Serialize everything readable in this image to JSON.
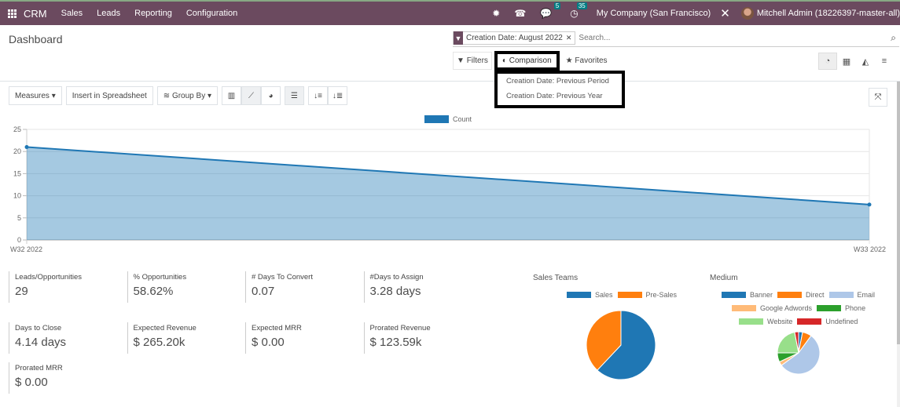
{
  "navbar": {
    "app_name": "CRM",
    "menus": [
      "Sales",
      "Leads",
      "Reporting",
      "Configuration"
    ],
    "messages_badge": "5",
    "activities_badge": "35",
    "company": "My Company (San Francisco)",
    "user": "Mitchell Admin (18226397-master-all)"
  },
  "control": {
    "title": "Dashboard",
    "facet_label": "Creation Date: August 2022",
    "search_placeholder": "Search...",
    "filters_label": "Filters",
    "comparison_label": "Comparison",
    "favorites_label": "Favorites",
    "comparison_options": [
      "Creation Date: Previous Period",
      "Creation Date: Previous Year"
    ],
    "views": [
      "dashboard",
      "pivot",
      "graph",
      "list"
    ],
    "active_view": "dashboard"
  },
  "toolbar": {
    "measures_label": "Measures",
    "insert_label": "Insert in Spreadsheet",
    "group_by_label": "Group By",
    "active_chart_mode": "line",
    "stacked": true
  },
  "kpis": [
    {
      "label": "Leads/Opportunities",
      "value": "29"
    },
    {
      "label": "% Opportunities",
      "value": "58.62%"
    },
    {
      "label": "# Days To Convert",
      "value": "0.07"
    },
    {
      "label": "#Days to Assign",
      "value": "3.28 days"
    },
    {
      "label": "Days to Close",
      "value": "4.14 days"
    },
    {
      "label": "Expected Revenue",
      "value": "$ 265.20k"
    },
    {
      "label": "Expected MRR",
      "value": "$ 0.00"
    },
    {
      "label": "Prorated Revenue",
      "value": "$ 123.59k"
    },
    {
      "label": "Prorated MRR",
      "value": "$ 0.00"
    }
  ],
  "chart_data": [
    {
      "type": "area",
      "title": "",
      "legend": [
        "Count"
      ],
      "legend_position": "top-center",
      "x": [
        "W32 2022",
        "W33 2022"
      ],
      "series": [
        {
          "name": "Count",
          "values": [
            21,
            8
          ],
          "color": "#1f77b4"
        }
      ],
      "yticks": [
        0,
        5,
        10,
        15,
        20,
        25
      ],
      "ylim": [
        0,
        25
      ],
      "xlabel": "",
      "ylabel": "",
      "grid": true
    },
    {
      "type": "pie",
      "title": "Sales Teams",
      "labels": [
        "Sales",
        "Pre-Sales"
      ],
      "values": [
        62,
        38
      ],
      "colors": [
        "#1f77b4",
        "#ff7f0e"
      ]
    },
    {
      "type": "pie",
      "title": "Medium",
      "labels": [
        "Banner",
        "Direct",
        "Email",
        "Google Adwords",
        "Phone",
        "Website",
        "Undefined"
      ],
      "values": [
        3,
        7,
        55,
        3,
        7,
        22,
        3
      ],
      "colors": [
        "#1f77b4",
        "#ff7f0e",
        "#aec7e8",
        "#ffbb78",
        "#2ca02c",
        "#98df8a",
        "#d62728"
      ]
    }
  ]
}
